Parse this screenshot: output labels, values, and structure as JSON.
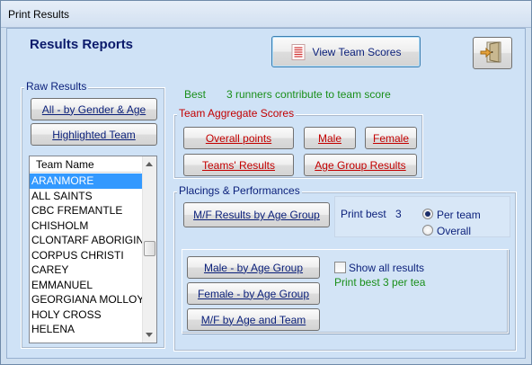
{
  "window": {
    "title": "Print Results"
  },
  "header": {
    "title": "Results Reports",
    "view_team_scores": "View Team Scores"
  },
  "best_info": {
    "prefix": "Best",
    "text": "3 runners contribute to team score"
  },
  "raw_results": {
    "label": "Raw Results",
    "all_by_gender_age": "All - by Gender & Age",
    "highlighted_team": "Highlighted Team",
    "list_header": "Team Name",
    "teams": [
      "ARANMORE",
      "ALL SAINTS",
      "CBC FREMANTLE",
      "CHISHOLM",
      "CLONTARF ABORIGINAL",
      "CORPUS CHRISTI",
      "CAREY",
      "EMMANUEL",
      "GEORGIANA MOLLOY",
      "HOLY CROSS",
      "HELENA"
    ],
    "selected_index": 0
  },
  "team_aggregate": {
    "label": "Team Aggregate Scores",
    "overall_points": "Overall points",
    "male": "Male",
    "female": "Female",
    "teams_results": "Teams' Results",
    "age_group_results": "Age Group Results"
  },
  "placings": {
    "label": "Placings & Performances",
    "mf_results_by_age_group": "M/F Results by Age Group",
    "print_best_label": "Print best",
    "print_best_value": "3",
    "per_team": "Per team",
    "overall": "Overall",
    "selected_option": "Per team",
    "male_by_age_group": "Male - by Age Group",
    "female_by_age_group": "Female - by Age Group",
    "mf_by_age_and_team": "M/F by Age and Team",
    "show_all_results": "Show all results",
    "show_all_checked": false,
    "print_best_per_team": "Print best 3 per tea"
  },
  "colors": {
    "navy_text": "#0a1f7a",
    "red_text": "#c30000",
    "green_text": "#1a8f1a",
    "selection": "#3399ff",
    "panel": "#cfe2f6"
  }
}
